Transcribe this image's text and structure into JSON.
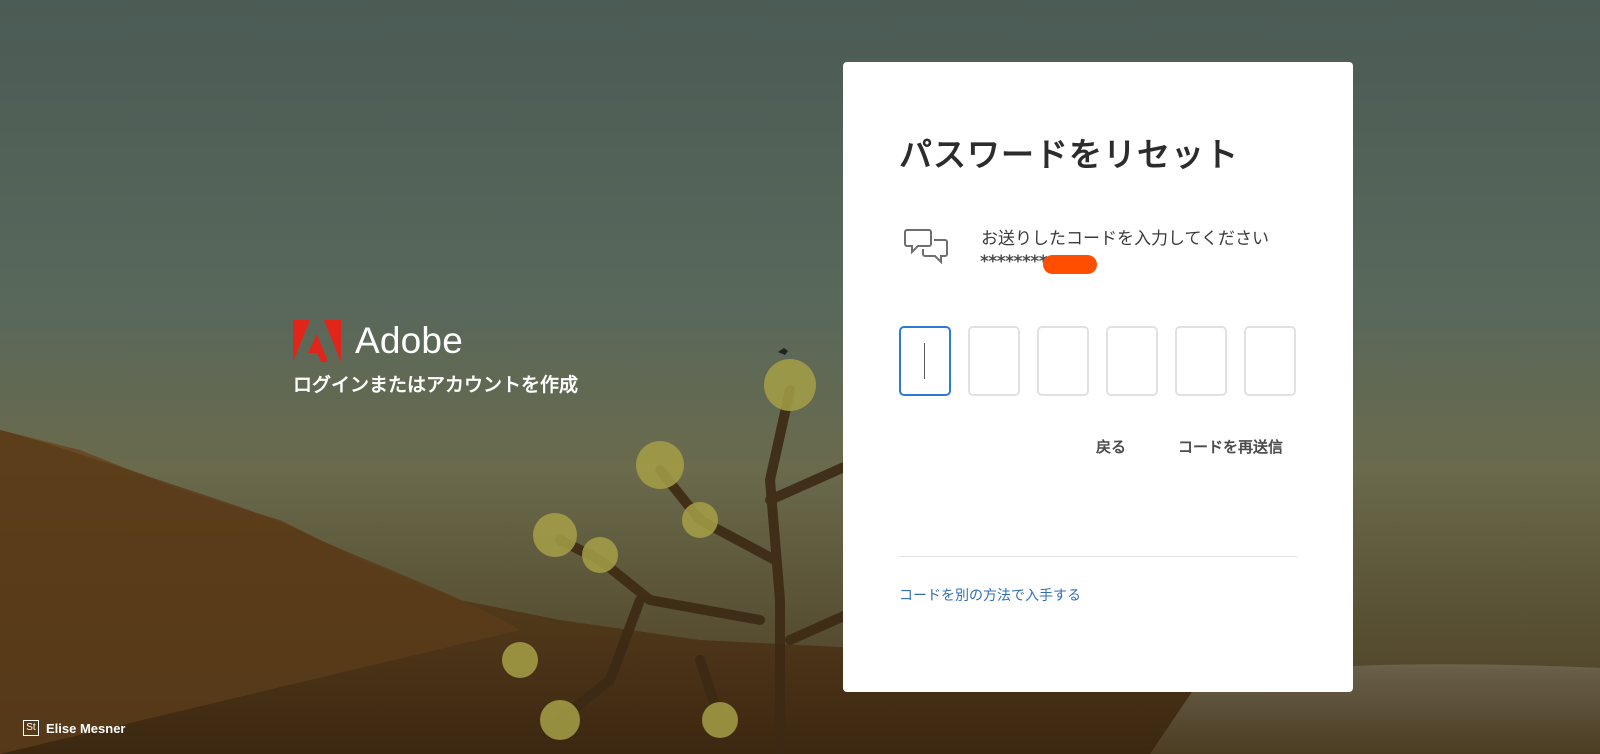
{
  "brand": {
    "name": "Adobe",
    "tagline": "ログインまたはアカウントを作成",
    "logo_color": "#e1251b"
  },
  "card": {
    "title": "パスワードをリセット",
    "instruction": "お送りしたコードを入力してください",
    "masked_phone": "********",
    "code_digits": [
      "",
      "",
      "",
      "",
      "",
      ""
    ],
    "back_label": "戻る",
    "resend_label": "コードを再送信",
    "alt_method_label": "コードを別の方法で入手する"
  },
  "photo_credit": {
    "icon_text": "St",
    "name": "Elise Mesner"
  },
  "colors": {
    "accent": "#2d7bd5",
    "link": "#2f6fb7",
    "redaction": "#ff4e00"
  },
  "icons": {
    "brand_logo": "adobe-logo",
    "instruction_icon": "chat-bubbles-icon",
    "credit_icon": "adobe-stock-icon"
  }
}
